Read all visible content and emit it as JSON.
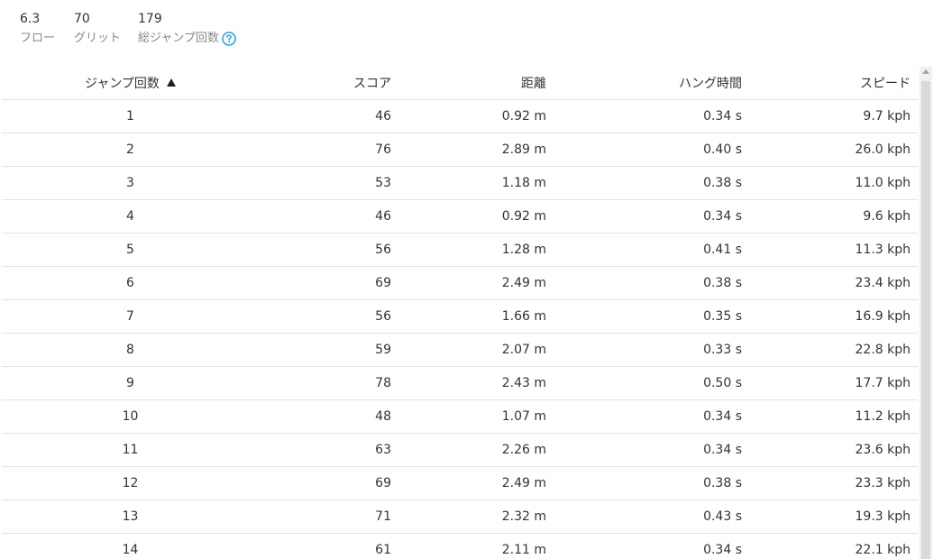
{
  "stats": [
    {
      "value": "6.3",
      "label": "フロー"
    },
    {
      "value": "70",
      "label": "グリット"
    },
    {
      "value": "179",
      "label": "総ジャンプ回数"
    }
  ],
  "help_icon": {
    "name": "question-circle-icon",
    "color": "#29a3dc"
  },
  "table": {
    "sort": {
      "column": "ジャンプ回数",
      "direction": "ascending"
    },
    "headers": [
      "ジャンプ回数",
      "スコア",
      "距離",
      "ハング時間",
      "スピード"
    ],
    "rows": [
      [
        "1",
        "46",
        "0.92 m",
        "0.34 s",
        "9.7 kph"
      ],
      [
        "2",
        "76",
        "2.89 m",
        "0.40 s",
        "26.0 kph"
      ],
      [
        "3",
        "53",
        "1.18 m",
        "0.38 s",
        "11.0 kph"
      ],
      [
        "4",
        "46",
        "0.92 m",
        "0.34 s",
        "9.6 kph"
      ],
      [
        "5",
        "56",
        "1.28 m",
        "0.41 s",
        "11.3 kph"
      ],
      [
        "6",
        "69",
        "2.49 m",
        "0.38 s",
        "23.4 kph"
      ],
      [
        "7",
        "56",
        "1.66 m",
        "0.35 s",
        "16.9 kph"
      ],
      [
        "8",
        "59",
        "2.07 m",
        "0.33 s",
        "22.8 kph"
      ],
      [
        "9",
        "78",
        "2.43 m",
        "0.50 s",
        "17.7 kph"
      ],
      [
        "10",
        "48",
        "1.07 m",
        "0.34 s",
        "11.2 kph"
      ],
      [
        "11",
        "63",
        "2.26 m",
        "0.34 s",
        "23.6 kph"
      ],
      [
        "12",
        "69",
        "2.49 m",
        "0.38 s",
        "23.3 kph"
      ],
      [
        "13",
        "71",
        "2.32 m",
        "0.43 s",
        "19.3 kph"
      ],
      [
        "14",
        "61",
        "2.11 m",
        "0.34 s",
        "22.1 kph"
      ]
    ]
  }
}
